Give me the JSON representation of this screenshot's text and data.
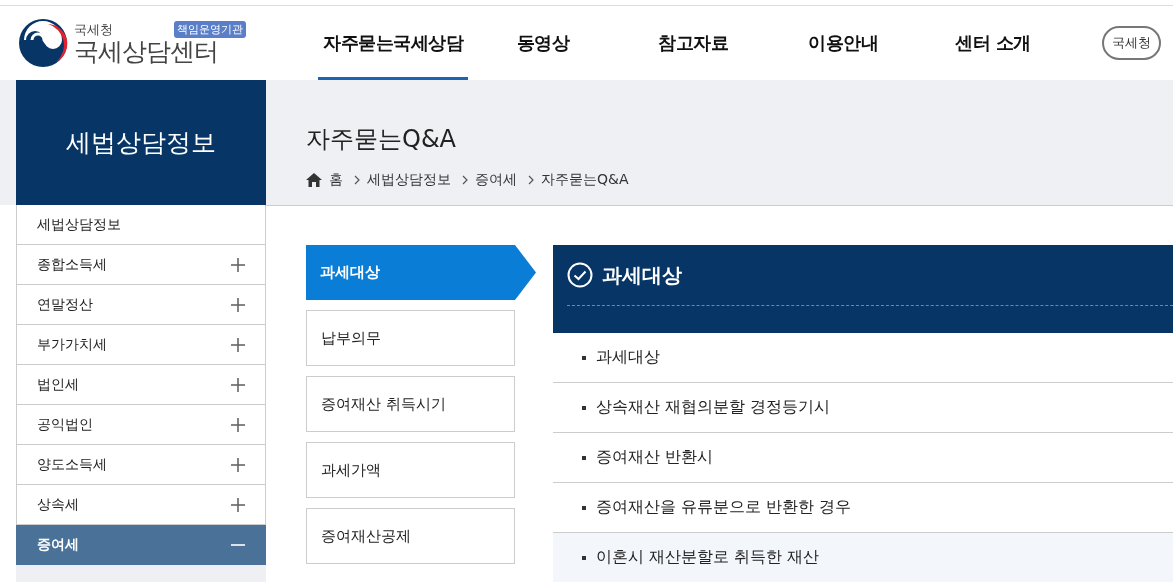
{
  "header": {
    "logo_small": "국세청",
    "logo_title": "국세상담센터",
    "logo_badge": "책임운영기관",
    "nav": [
      {
        "label": "자주묻는국세상담",
        "selected": true
      },
      {
        "label": "동영상",
        "selected": false
      },
      {
        "label": "참고자료",
        "selected": false
      },
      {
        "label": "이용안내",
        "selected": false
      },
      {
        "label": "센터 소개",
        "selected": false
      }
    ],
    "nts_button": "국세청"
  },
  "sidebar": {
    "title": "세법상담정보",
    "items": [
      {
        "label": "세법상담정보",
        "kind": "link",
        "selected": false
      },
      {
        "label": "종합소득세",
        "kind": "group",
        "expanded": false,
        "selected": false
      },
      {
        "label": "연말정산",
        "kind": "group",
        "expanded": false,
        "selected": false
      },
      {
        "label": "부가가치세",
        "kind": "group",
        "expanded": false,
        "selected": false
      },
      {
        "label": "법인세",
        "kind": "group",
        "expanded": false,
        "selected": false
      },
      {
        "label": "공익법인",
        "kind": "group",
        "expanded": false,
        "selected": false
      },
      {
        "label": "양도소득세",
        "kind": "group",
        "expanded": false,
        "selected": false
      },
      {
        "label": "상속세",
        "kind": "group",
        "expanded": false,
        "selected": false
      },
      {
        "label": "증여세",
        "kind": "group",
        "expanded": true,
        "selected": true
      }
    ]
  },
  "page": {
    "title": "자주묻는Q&A",
    "breadcrumb": [
      "홈",
      "세법상담정보",
      "증여세",
      "자주묻는Q&A"
    ]
  },
  "tabs": [
    {
      "label": "과세대상",
      "selected": true
    },
    {
      "label": "납부의무",
      "selected": false
    },
    {
      "label": "증여재산 취득시기",
      "selected": false
    },
    {
      "label": "과세가액",
      "selected": false
    },
    {
      "label": "증여재산공제",
      "selected": false
    }
  ],
  "panel": {
    "title": "과세대상",
    "items": [
      {
        "label": "과세대상",
        "highlighted": false
      },
      {
        "label": "상속재산 재협의분할 경정등기시",
        "highlighted": false
      },
      {
        "label": "증여재산 반환시",
        "highlighted": false
      },
      {
        "label": "증여재산을 유류분으로 반환한 경우",
        "highlighted": false
      },
      {
        "label": "이혼시 재산분할로 취득한 재산",
        "highlighted": true
      }
    ]
  }
}
